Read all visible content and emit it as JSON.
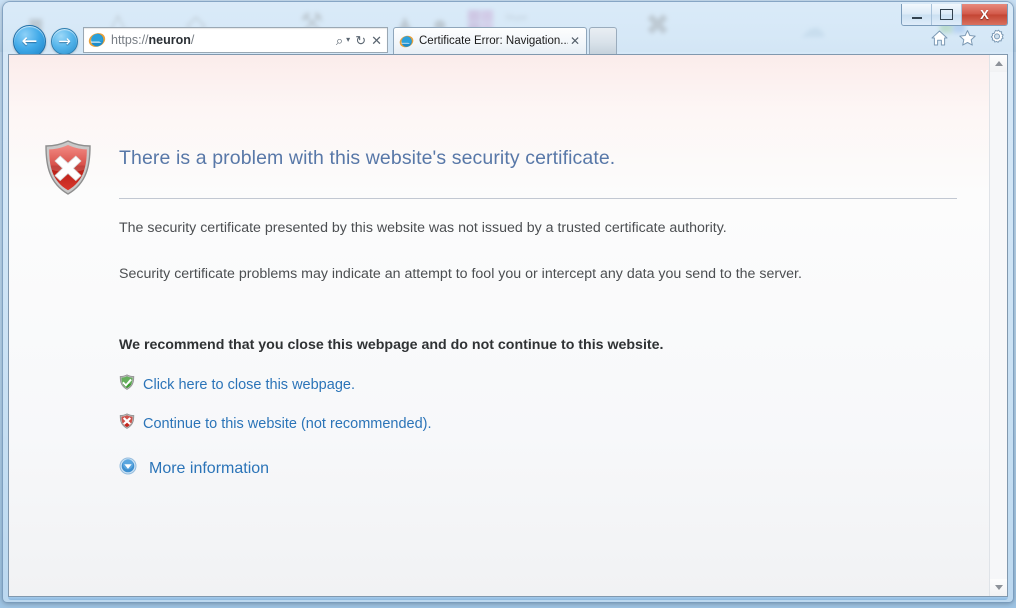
{
  "window": {
    "caption_buttons": [
      {
        "name": "minimize",
        "label": "—"
      },
      {
        "name": "maximize",
        "label": "□"
      },
      {
        "name": "close",
        "label": "X"
      }
    ]
  },
  "toolbar": {
    "back_label": "←",
    "forward_label": "→",
    "address": {
      "url_prefix": "https://",
      "url_host": "neuron",
      "url_suffix": "/",
      "full_url": "https://neuron/",
      "placeholder": "https://neuron/",
      "search_icon": "search-icon",
      "dropdown_icon": "chevron-down-icon",
      "refresh_icon": "refresh-icon",
      "stop_icon": "stop-icon",
      "refresh_label": "↻",
      "stop_label": "✕",
      "search_label": "⌕",
      "caret_label": "▾"
    },
    "command_icons": [
      {
        "name": "home-icon",
        "title": "Home"
      },
      {
        "name": "favorites-icon",
        "title": "Favorites"
      },
      {
        "name": "tools-icon",
        "title": "Tools"
      }
    ]
  },
  "tabs": {
    "items": [
      {
        "title": "Certificate Error: Navigation...",
        "close_label": "✕",
        "active": true
      }
    ],
    "new_tab_label": ""
  },
  "page": {
    "icon": "red-shield-error-icon",
    "heading": "There is a problem with this website's security certificate.",
    "paragraphs": [
      "The security certificate presented by this website was not issued by a trusted certificate authority.",
      "Security certificate problems may indicate an attempt to fool you or intercept any data you send to the server."
    ],
    "recommendation": "We recommend that you close this webpage and do not continue to this website.",
    "links": [
      {
        "icon": "green-shield-ok-icon",
        "label": "Click here to close this webpage."
      },
      {
        "icon": "red-shield-error-icon",
        "label": "Continue to this website (not recommended)."
      },
      {
        "icon": "expand-chevron-icon",
        "label": "More information"
      }
    ]
  },
  "scrollbar": {
    "up_label": "▲",
    "down_label": "▼"
  },
  "colors": {
    "heading": "#5878a8",
    "link": "#2b74b8",
    "error_red": "#c4261d",
    "ok_green": "#3f9b34",
    "accent_blue": "#2a8fcd",
    "body_text": "#4c4f52"
  },
  "desktop": {
    "icons": [
      {
        "glyph": "⬛",
        "caption": ""
      },
      {
        "glyph": "△",
        "caption": ""
      },
      {
        "glyph": "◇",
        "caption": ""
      },
      {
        "glyph": "⚒",
        "caption": ""
      },
      {
        "glyph": "●",
        "caption": ""
      },
      {
        "glyph": "⬟",
        "caption": ""
      },
      {
        "glyph": "✖",
        "caption": ""
      },
      {
        "glyph": "☁",
        "caption": ""
      }
    ]
  }
}
